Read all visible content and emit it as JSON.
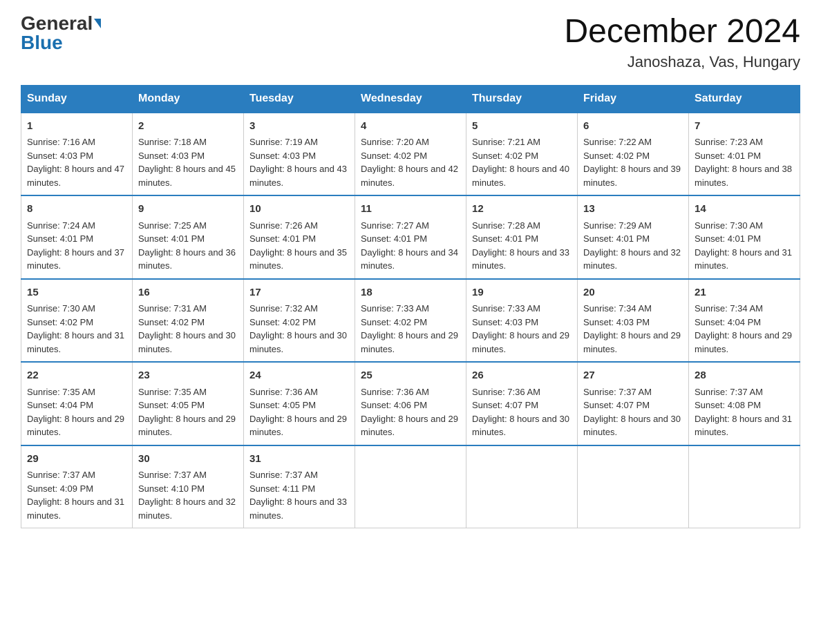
{
  "header": {
    "logo_general": "General",
    "logo_blue": "Blue",
    "title": "December 2024",
    "location": "Janoshaza, Vas, Hungary"
  },
  "days_of_week": [
    "Sunday",
    "Monday",
    "Tuesday",
    "Wednesday",
    "Thursday",
    "Friday",
    "Saturday"
  ],
  "weeks": [
    [
      {
        "day": "1",
        "sunrise": "7:16 AM",
        "sunset": "4:03 PM",
        "daylight": "8 hours and 47 minutes."
      },
      {
        "day": "2",
        "sunrise": "7:18 AM",
        "sunset": "4:03 PM",
        "daylight": "8 hours and 45 minutes."
      },
      {
        "day": "3",
        "sunrise": "7:19 AM",
        "sunset": "4:03 PM",
        "daylight": "8 hours and 43 minutes."
      },
      {
        "day": "4",
        "sunrise": "7:20 AM",
        "sunset": "4:02 PM",
        "daylight": "8 hours and 42 minutes."
      },
      {
        "day": "5",
        "sunrise": "7:21 AM",
        "sunset": "4:02 PM",
        "daylight": "8 hours and 40 minutes."
      },
      {
        "day": "6",
        "sunrise": "7:22 AM",
        "sunset": "4:02 PM",
        "daylight": "8 hours and 39 minutes."
      },
      {
        "day": "7",
        "sunrise": "7:23 AM",
        "sunset": "4:01 PM",
        "daylight": "8 hours and 38 minutes."
      }
    ],
    [
      {
        "day": "8",
        "sunrise": "7:24 AM",
        "sunset": "4:01 PM",
        "daylight": "8 hours and 37 minutes."
      },
      {
        "day": "9",
        "sunrise": "7:25 AM",
        "sunset": "4:01 PM",
        "daylight": "8 hours and 36 minutes."
      },
      {
        "day": "10",
        "sunrise": "7:26 AM",
        "sunset": "4:01 PM",
        "daylight": "8 hours and 35 minutes."
      },
      {
        "day": "11",
        "sunrise": "7:27 AM",
        "sunset": "4:01 PM",
        "daylight": "8 hours and 34 minutes."
      },
      {
        "day": "12",
        "sunrise": "7:28 AM",
        "sunset": "4:01 PM",
        "daylight": "8 hours and 33 minutes."
      },
      {
        "day": "13",
        "sunrise": "7:29 AM",
        "sunset": "4:01 PM",
        "daylight": "8 hours and 32 minutes."
      },
      {
        "day": "14",
        "sunrise": "7:30 AM",
        "sunset": "4:01 PM",
        "daylight": "8 hours and 31 minutes."
      }
    ],
    [
      {
        "day": "15",
        "sunrise": "7:30 AM",
        "sunset": "4:02 PM",
        "daylight": "8 hours and 31 minutes."
      },
      {
        "day": "16",
        "sunrise": "7:31 AM",
        "sunset": "4:02 PM",
        "daylight": "8 hours and 30 minutes."
      },
      {
        "day": "17",
        "sunrise": "7:32 AM",
        "sunset": "4:02 PM",
        "daylight": "8 hours and 30 minutes."
      },
      {
        "day": "18",
        "sunrise": "7:33 AM",
        "sunset": "4:02 PM",
        "daylight": "8 hours and 29 minutes."
      },
      {
        "day": "19",
        "sunrise": "7:33 AM",
        "sunset": "4:03 PM",
        "daylight": "8 hours and 29 minutes."
      },
      {
        "day": "20",
        "sunrise": "7:34 AM",
        "sunset": "4:03 PM",
        "daylight": "8 hours and 29 minutes."
      },
      {
        "day": "21",
        "sunrise": "7:34 AM",
        "sunset": "4:04 PM",
        "daylight": "8 hours and 29 minutes."
      }
    ],
    [
      {
        "day": "22",
        "sunrise": "7:35 AM",
        "sunset": "4:04 PM",
        "daylight": "8 hours and 29 minutes."
      },
      {
        "day": "23",
        "sunrise": "7:35 AM",
        "sunset": "4:05 PM",
        "daylight": "8 hours and 29 minutes."
      },
      {
        "day": "24",
        "sunrise": "7:36 AM",
        "sunset": "4:05 PM",
        "daylight": "8 hours and 29 minutes."
      },
      {
        "day": "25",
        "sunrise": "7:36 AM",
        "sunset": "4:06 PM",
        "daylight": "8 hours and 29 minutes."
      },
      {
        "day": "26",
        "sunrise": "7:36 AM",
        "sunset": "4:07 PM",
        "daylight": "8 hours and 30 minutes."
      },
      {
        "day": "27",
        "sunrise": "7:37 AM",
        "sunset": "4:07 PM",
        "daylight": "8 hours and 30 minutes."
      },
      {
        "day": "28",
        "sunrise": "7:37 AM",
        "sunset": "4:08 PM",
        "daylight": "8 hours and 31 minutes."
      }
    ],
    [
      {
        "day": "29",
        "sunrise": "7:37 AM",
        "sunset": "4:09 PM",
        "daylight": "8 hours and 31 minutes."
      },
      {
        "day": "30",
        "sunrise": "7:37 AM",
        "sunset": "4:10 PM",
        "daylight": "8 hours and 32 minutes."
      },
      {
        "day": "31",
        "sunrise": "7:37 AM",
        "sunset": "4:11 PM",
        "daylight": "8 hours and 33 minutes."
      },
      null,
      null,
      null,
      null
    ]
  ]
}
